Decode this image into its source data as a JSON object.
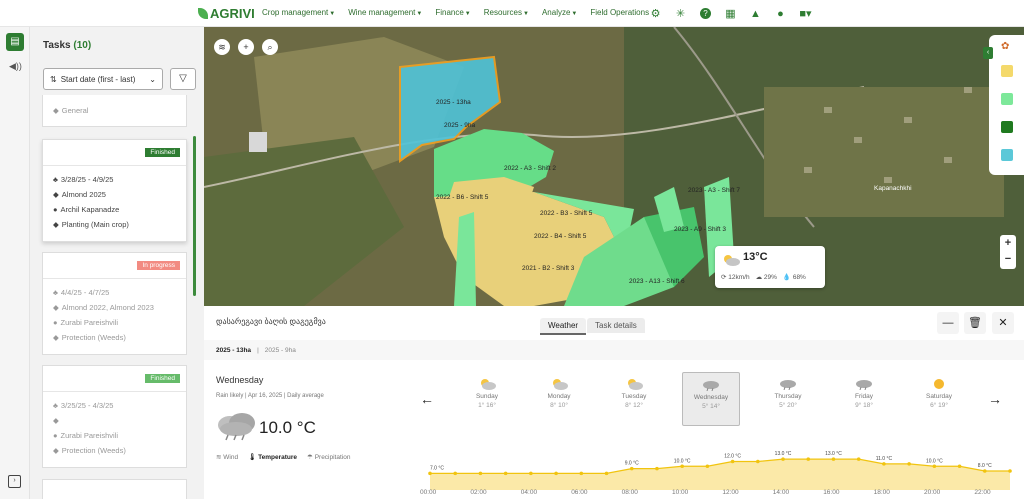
{
  "topbar": {
    "brand": "AGRIVI",
    "nav": [
      "Crop management",
      "Wine management",
      "Finance",
      "Resources",
      "Analyze",
      "Field Operations"
    ],
    "nav_has_dropdown": [
      true,
      true,
      true,
      true,
      true,
      false
    ],
    "icons": [
      "gear-icon",
      "network-icon",
      "help-icon",
      "calendar-icon",
      "bell-icon",
      "chat-icon",
      "app-switcher-icon"
    ]
  },
  "tasks": {
    "title": "Tasks",
    "count": "(10)",
    "sort_label": "Start date (first - last)",
    "cards": [
      {
        "status": "",
        "dates": "",
        "crop": "General",
        "assignee": "",
        "operation": ""
      },
      {
        "status": "Finished",
        "status_color": "#2e7d32",
        "dates": "3/28/25 - 4/9/25",
        "crop": "Almond 2025",
        "assignee": "Archil Kapanadze",
        "operation": "Planting (Main crop)"
      },
      {
        "status": "In progress",
        "status_color": "#f28b82",
        "dates": "4/4/25 - 4/7/25",
        "crop": "Almond 2022, Almond 2023",
        "assignee": "Zurabi Pareishvili",
        "operation": "Protection (Weeds)"
      },
      {
        "status": "Finished",
        "status_color": "#66bb6a",
        "dates": "3/25/25 - 4/3/25",
        "crop": "",
        "assignee": "Zurabi Pareishvili",
        "operation": "Protection (Weeds)"
      }
    ]
  },
  "map": {
    "labels": [
      "2025 - 13ha",
      "2025 - 9ha",
      "2022 - A3 - Shift 2",
      "2022 - B6 - Shift 5",
      "2022 - B3 - Shift 5",
      "2023 - A3 - Shift 7",
      "2022 - B4 - Shift 5",
      "2023 - A9 - Shift 3",
      "2021 - B2 - Shift 3",
      "2023 - A13 - Shift 6",
      "Kapanachkhi"
    ],
    "legend_colors": [
      "#f4d96b",
      "#7de89a",
      "#1f7a1f",
      "#5bc8d8"
    ],
    "weather_popup": {
      "temp": "13°C",
      "wind": "12km/h",
      "clouds": "29%",
      "humidity": "68%"
    }
  },
  "panel": {
    "title": "დასარეგავი ბაღის დაგეგმვა",
    "tabs": [
      "Weather",
      "Task details"
    ],
    "field_primary": "2025 - 13ha",
    "field_secondary": "2025 - 9ha",
    "day": "Wednesday",
    "meta": [
      "Rain likely",
      "Apr 16, 2025",
      "Daily average"
    ],
    "current_temp": "10.0 °C",
    "modes": [
      "Wind",
      "Temperature",
      "Precipitation"
    ],
    "days": [
      {
        "name": "Sunday",
        "range": "1° 16°",
        "icon": "sun-cloud"
      },
      {
        "name": "Monday",
        "range": "8° 10°",
        "icon": "sun-cloud"
      },
      {
        "name": "Tuesday",
        "range": "8° 12°",
        "icon": "sun-cloud"
      },
      {
        "name": "Wednesday",
        "range": "5° 14°",
        "icon": "rain-cloud"
      },
      {
        "name": "Thursday",
        "range": "5° 20°",
        "icon": "rain-cloud"
      },
      {
        "name": "Friday",
        "range": "9° 18°",
        "icon": "rain-cloud"
      },
      {
        "name": "Saturday",
        "range": "6° 19°",
        "icon": "sun"
      }
    ],
    "hours": [
      "00:00",
      "02:00",
      "04:00",
      "06:00",
      "08:00",
      "10:00",
      "12:00",
      "14:00",
      "16:00",
      "18:00",
      "20:00",
      "22:00"
    ]
  },
  "chart_data": {
    "type": "area",
    "x": [
      0,
      1,
      2,
      3,
      4,
      5,
      6,
      7,
      8,
      9,
      10,
      11,
      12,
      13,
      14,
      15,
      16,
      17,
      18,
      19,
      20,
      21,
      22,
      23
    ],
    "values": [
      7.0,
      7.0,
      7.0,
      7.0,
      7.0,
      7.0,
      7.0,
      7.0,
      9.0,
      9.0,
      10.0,
      10.0,
      12.0,
      12.0,
      13.0,
      13.0,
      13.0,
      13.0,
      11.0,
      11.0,
      10.0,
      10.0,
      8.0,
      8.0
    ],
    "labels": [
      "7.0 °C",
      "9.0 °C",
      "10.0 °C",
      "12.0 °C",
      "13.0 °C",
      "13.0 °C",
      "11.0 °C",
      "10.0 °C",
      "8.0 °C"
    ],
    "label_hours": [
      0,
      8,
      10,
      12,
      14,
      16,
      18,
      20,
      22
    ]
  }
}
